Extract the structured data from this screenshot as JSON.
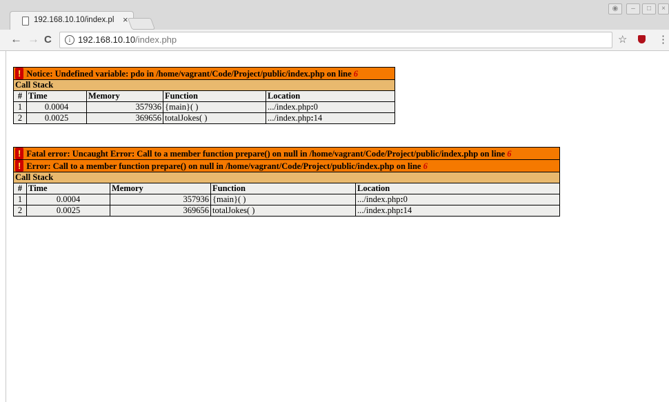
{
  "browser": {
    "tab_title": "192.168.10.10/index.pl",
    "tab_close": "×",
    "url_host": "192.168.10.10",
    "url_path": "/index.php",
    "back_icon": "←",
    "forward_icon": "→",
    "reload_icon": "C",
    "info_icon": "i",
    "star_icon": "☆",
    "menu_icon": "⋮"
  },
  "notice": {
    "icon": "!",
    "message": "Notice: Undefined variable: pdo in /home/vagrant/Code/Project/public/index.php on line ",
    "line": "6",
    "call_stack_label": "Call Stack",
    "headers": [
      "#",
      "Time",
      "Memory",
      "Function",
      "Location"
    ],
    "rows": [
      {
        "n": "1",
        "time": "0.0004",
        "memory": "357936",
        "function": "{main}( )",
        "location_prefix": ".../index.php",
        "location_sep": ":",
        "location_line": "0"
      },
      {
        "n": "2",
        "time": "0.0025",
        "memory": "369656",
        "function": "totalJokes( )",
        "location_prefix": ".../index.php",
        "location_sep": ":",
        "location_line": "14"
      }
    ]
  },
  "fatal": {
    "icon": "!",
    "message": "Fatal error: Uncaught Error: Call to a member function prepare() on null in /home/vagrant/Code/Project/public/index.php on line ",
    "line": "6",
    "error_message": "Error: Call to a member function prepare() on null in /home/vagrant/Code/Project/public/index.php on line ",
    "error_line": "6",
    "call_stack_label": "Call Stack",
    "headers": [
      "#",
      "Time",
      "Memory",
      "Function",
      "Location"
    ],
    "rows": [
      {
        "n": "1",
        "time": "0.0004",
        "memory": "357936",
        "function": "{main}( )",
        "location_prefix": ".../index.php",
        "location_sep": ":",
        "location_line": "0"
      },
      {
        "n": "2",
        "time": "0.0025",
        "memory": "369656",
        "function": "totalJokes( )",
        "location_prefix": ".../index.php",
        "location_sep": ":",
        "location_line": "14"
      }
    ]
  }
}
